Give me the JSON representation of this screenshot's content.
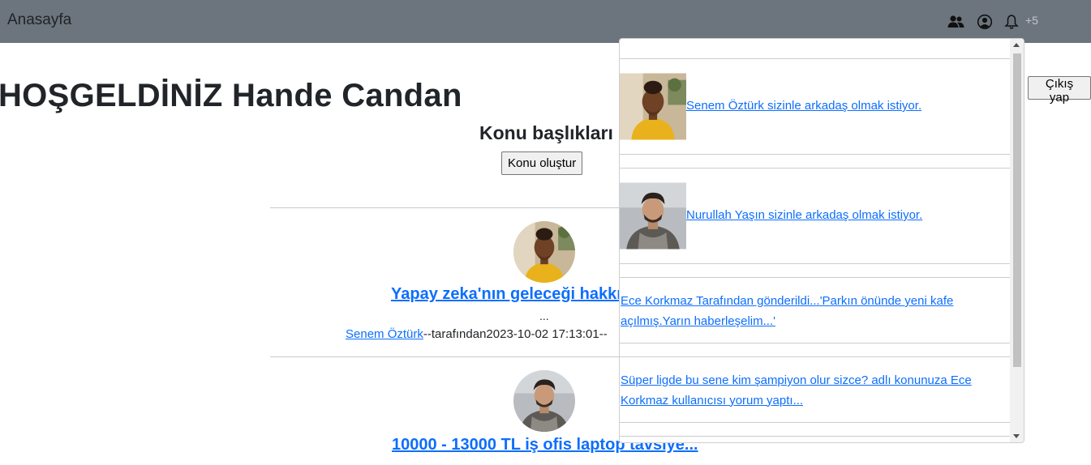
{
  "navbar": {
    "brand": "Anasayfa",
    "notification_count": "+5",
    "icons": [
      "friends-icon",
      "profile-icon",
      "bell-icon"
    ],
    "background": "#6c757d"
  },
  "main": {
    "welcome": "HOŞGELDİNİZ Hande Candan",
    "section_title": "Konu başlıkları",
    "create_topic_label": "Konu oluştur",
    "logout_label": "Çıkış yap"
  },
  "posts": [
    {
      "title": "Yapay zeka'nın geleceği hakkı",
      "excerpt": "...",
      "author": "Senem Öztürk",
      "meta": "--tarafından2023-10-02 17:13:01--"
    },
    {
      "title": "10000 - 13000 TL iş ofis laptop tavsiye..."
    }
  ],
  "notifications": [
    {
      "text": "Senem Öztürk sizinle arkadaş olmak istiyor."
    },
    {
      "text": "Nurullah Yaşın sizinle arkadaş olmak istiyor."
    },
    {
      "text": "Ece Korkmaz Tarafından gönderildi...'Parkın önünde yeni kafe açılmış.Yarın haberleşelim...'"
    },
    {
      "text": "Süper ligde bu sene kim şampiyon olur sizce? adlı konunuza Ece Korkmaz kullanıcısı yorum yaptı..."
    }
  ],
  "colors": {
    "link": "#0d6efd",
    "navbar": "#6c757d"
  }
}
